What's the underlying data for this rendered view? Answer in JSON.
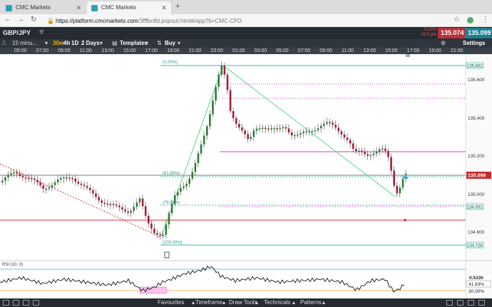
{
  "browser": {
    "tabs": [
      {
        "label": "CMC Markets",
        "active": false
      },
      {
        "label": "CMC Markets",
        "active": true
      }
    ],
    "url_host": "https://platform.cmcmarkets.com",
    "url_path": "/3fffbc8d.popout.html#/app?b=CMC-CFD"
  },
  "toolbar": {
    "symbol": "GBP/JPY",
    "change_top": "0.13%",
    "change_bottom": "23.9 pts",
    "sell_price": "135.074",
    "buy_price": "135.099",
    "timeframe": "15 minu...",
    "intervals": [
      "30m",
      "4h",
      "1D"
    ],
    "active_interval": "30m",
    "range": "2 Days",
    "templates": "Templates",
    "buy_label": "Buy",
    "settings": "Settings"
  },
  "time_axis": [
    "05:00",
    "07:00",
    "09:00",
    "11:00",
    "13:00",
    "15:00",
    "17:00",
    "19:00",
    "21:00",
    "23:00",
    "01:00",
    "03:00",
    "05:00",
    "07:00",
    "09:00",
    "11:00",
    "13:00",
    "15:00",
    "17:00",
    "19:00",
    "21:00"
  ],
  "price_axis": {
    "labels": [
      "135.600",
      "135.400",
      "135.200",
      "135.000",
      "134.800"
    ],
    "current": "135.099",
    "level_top": "135.662",
    "level_mid": "134.931",
    "level_bottom": "134.728"
  },
  "fib_labels": {
    "top": "(0.00%)",
    "f618": "(61.80%)",
    "f786": "(78.60%)",
    "bottom": "(100.00%)"
  },
  "rsi": {
    "label": "RSI (10, 0)",
    "value": "0.5330",
    "value_pct": "41.83%",
    "level_30": "30.00%"
  },
  "colors": {
    "bull": "#2e7d32",
    "bear": "#a32035",
    "fib_line": "#3cb8a0",
    "magenta": "#d040d0",
    "red_line": "#e03030",
    "current_bg": "#c82a2a"
  },
  "bottom_menu": [
    "Favourites",
    "Timeframe",
    "Draw Tools",
    "Technicals",
    "Patterns"
  ]
}
